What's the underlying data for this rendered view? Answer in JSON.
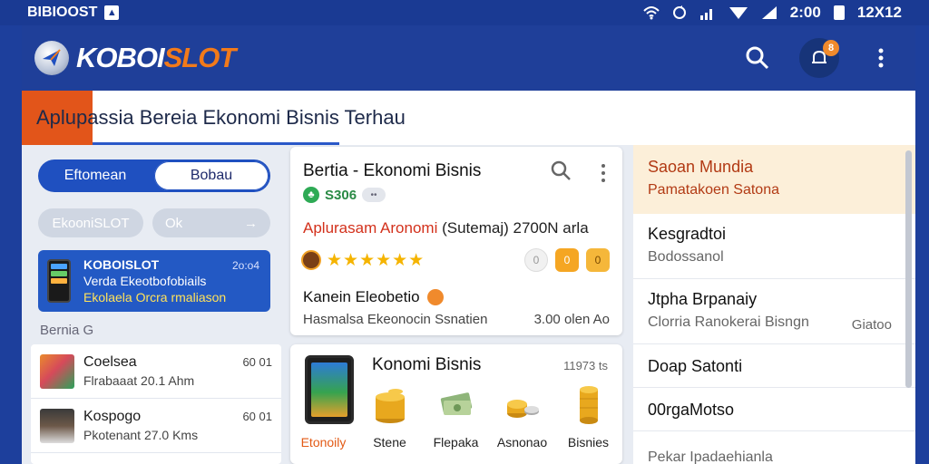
{
  "status_bar": {
    "carrier": "BIBIOOST",
    "time": "2:00",
    "clock": "12X12"
  },
  "app": {
    "logo_part1": "KOBOI",
    "logo_part2": "SLOT"
  },
  "title_bar": {
    "title": "Aplupassia Bereia Ekonomi Bisnis Terhau"
  },
  "notifications": {
    "badge": "8"
  },
  "left_panel": {
    "segment": [
      "Eftomean",
      "Bobau"
    ],
    "pills": [
      "EkooniSLOT",
      "Ok",
      "→"
    ],
    "promo": {
      "title": "KOBOISLOT",
      "line2": "Verda Ekeotbofobiails",
      "line3": "Ekolaela Orcra rmaliason",
      "time": "2o:o4"
    },
    "section_label": "Bernia G",
    "items": [
      {
        "name": "Coelsea",
        "sub": "Flrabaaat 20.1 Ahm",
        "time": "60 01"
      },
      {
        "name": "Kospogo",
        "sub": "Pkotenant 27.0 Kms",
        "time": "60 01"
      }
    ]
  },
  "card1": {
    "title": "Bertia - Ekonomi Bisnis",
    "score": "S306",
    "chip": "••",
    "headline": "Aplurasam Aronomi",
    "headline_rest": "(Sutemaj) 2700N arla",
    "stars": "★★★★★★",
    "btn0": "0",
    "btn1": "0",
    "btn2": "0",
    "sub_title": "Kanein Eleobetio",
    "sub_desc": "Hasmalsa Ekeonocin Ssnatien",
    "sub_meta": "3.00 olen Ao"
  },
  "card2": {
    "title": "Konomi Bisnis",
    "meta": "11973 ts",
    "categories": [
      "Etonoily",
      "Stene",
      "Flepaka",
      "Asnonao",
      "Bisnies"
    ]
  },
  "right_panel": {
    "head_title": "Saoan Mundia",
    "head_sub": "Pamatakoen Satona",
    "items": [
      {
        "name": "Kesgradtoi",
        "sub": "Bodossanol",
        "extra": ""
      },
      {
        "name": "Jtpha Brpanaiy",
        "sub": "Clorria Ranokerai Bisngn",
        "extra": "Giatoo"
      },
      {
        "name": "Doap Satonti",
        "sub": "",
        "extra": ""
      },
      {
        "name": "00rgaMotso",
        "sub": "",
        "extra": ""
      },
      {
        "name": "Pekar Ipadaehianla",
        "sub": "",
        "extra": ""
      }
    ]
  },
  "icons": [
    "wifi-icon",
    "sync-icon",
    "signal-icon",
    "battery-icon",
    "search-icon",
    "bell-icon",
    "more-icon",
    "coin-icon",
    "money-icon",
    "phone-icon"
  ],
  "colors": {
    "primary": "#1f3f99",
    "accent_orange": "#e2551a",
    "logo_orange": "#f27a1a",
    "star": "#f5b400",
    "headline_red": "#d3311c"
  }
}
